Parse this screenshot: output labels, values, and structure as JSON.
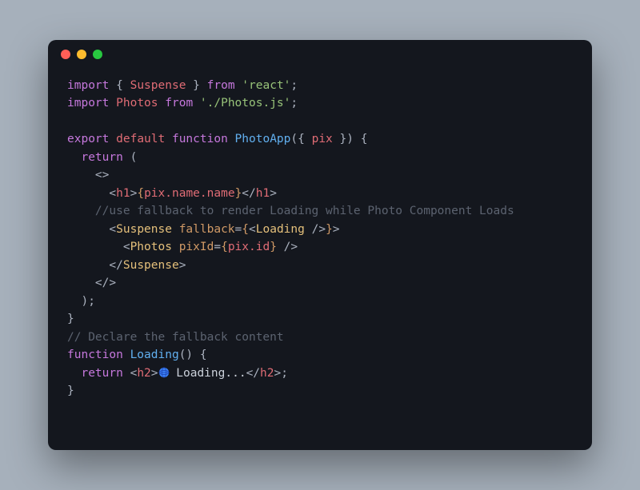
{
  "titlebar": {
    "close": "close",
    "minimize": "minimize",
    "zoom": "zoom"
  },
  "code": {
    "l1": {
      "import": "import",
      "brace_open": " { ",
      "suspense": "Suspense",
      "brace_close": " } ",
      "from": "from",
      "space": " ",
      "react_str": "'react'",
      "semi": ";"
    },
    "l2": {
      "import": "import",
      "space": " ",
      "photos": "Photos",
      "space2": " ",
      "from": "from",
      "space3": " ",
      "path_str": "'./Photos.js'",
      "semi": ";"
    },
    "l3": "",
    "l4": {
      "export": "export",
      "space": " ",
      "default": "default",
      "space2": " ",
      "function": "function",
      "space3": " ",
      "name": "PhotoApp",
      "paren_open": "(",
      "brace_open": "{ ",
      "param": "pix",
      "brace_close": " }",
      "paren_close_brace": ") {"
    },
    "l5": {
      "indent": "  ",
      "return": "return",
      "paren": " ("
    },
    "l6": {
      "indent": "    ",
      "frag": "<>"
    },
    "l7": {
      "indent": "      ",
      "open": "<",
      "h1": "h1",
      "close": ">",
      "brace_open": "{",
      "expr": "pix.name.name",
      "brace_close": "}",
      "close_open": "</",
      "h1_2": "h1",
      "close2": ">"
    },
    "l8": {
      "indent": "    ",
      "comment": "//use fallback to render Loading while Photo Component Loads"
    },
    "l9": {
      "indent": "      ",
      "open": "<",
      "suspense": "Suspense",
      "space": " ",
      "fallback": "fallback",
      "eq": "=",
      "brace_open": "{",
      "open2": "<",
      "loading": "Loading",
      "selfclose": " />",
      "brace_close": "}",
      "close": ">"
    },
    "l10": {
      "indent": "        ",
      "open": "<",
      "photos": "Photos",
      "space": " ",
      "pixid": "pixId",
      "eq": "=",
      "brace_open": "{",
      "expr": "pix.id",
      "brace_close": "}",
      "selfclose": " />"
    },
    "l11": {
      "indent": "      ",
      "close_open": "</",
      "suspense": "Suspense",
      "close": ">"
    },
    "l12": {
      "indent": "    ",
      "frag": "</>"
    },
    "l13": {
      "indent": "  ",
      "close": ");"
    },
    "l14": {
      "brace": "}"
    },
    "l15": {
      "comment": "// Declare the fallback content"
    },
    "l16": {
      "function": "function",
      "space": " ",
      "name": "Loading",
      "parens": "() {"
    },
    "l17": {
      "indent": "  ",
      "return": "return",
      "space": " ",
      "open": "<",
      "h2": "h2",
      "close": ">",
      "text": " Loading...",
      "close_open": "</",
      "h2_2": "h2",
      "close2": ">",
      "semi": ";"
    },
    "l18": {
      "brace": "}"
    }
  }
}
